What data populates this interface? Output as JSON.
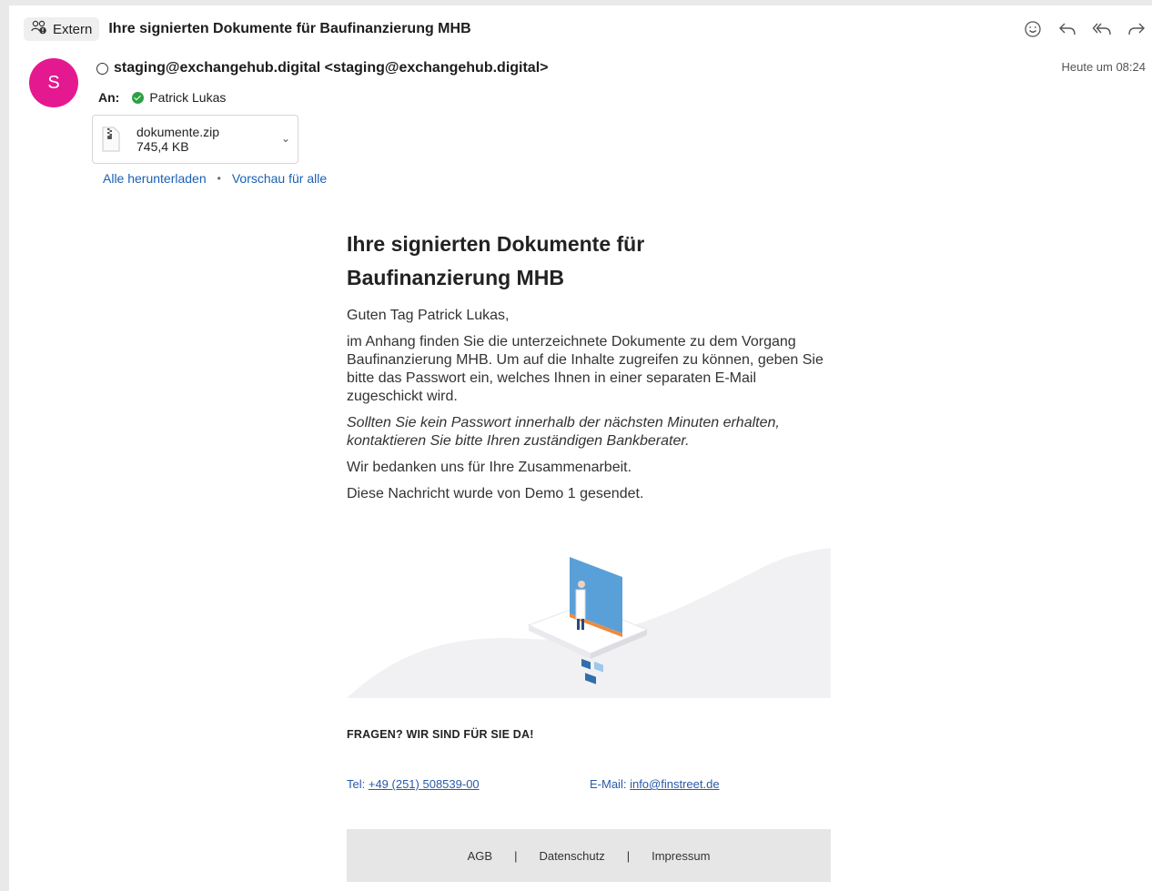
{
  "header": {
    "tag_label": "Extern",
    "subject": "Ihre signierten Dokumente für Baufinanzierung MHB",
    "actions": [
      "emoji-icon",
      "reply-icon",
      "reply-all-icon",
      "forward-icon"
    ]
  },
  "sender": {
    "avatar_letter": "S",
    "avatar_color": "#e4198f",
    "from": "staging@exchangehub.digital <staging@exchangehub.digital>",
    "date": "Heute um 08:24"
  },
  "recipients": {
    "label": "An:",
    "name": "Patrick Lukas"
  },
  "attachment": {
    "name": "dokumente.zip",
    "size": "745,4 KB",
    "download_all": "Alle herunterladen",
    "separator": "•",
    "preview_all": "Vorschau für alle"
  },
  "body": {
    "title": "Ihre signierten Dokumente für Baufinanzierung MHB",
    "greeting": "Guten Tag Patrick Lukas,",
    "paragraph1": "im Anhang finden Sie die unterzeichnete Dokumente zu dem Vorgang Baufinanzierung MHB. Um auf die Inhalte zugreifen zu können, geben Sie bitte das Passwort ein, welches Ihnen in einer separaten E-Mail zugeschickt wird.",
    "paragraph2": "Sollten Sie kein Passwort innerhalb der nächsten Minuten erhalten, kontaktieren Sie bitte Ihren zuständigen Bankberater.",
    "thanks": "Wir bedanken uns für Ihre Zusammenarbeit.",
    "sent_by": "Diese Nachricht wurde von Demo 1 gesendet."
  },
  "help": {
    "heading": "FRAGEN? WIR SIND FÜR SIE DA!",
    "tel_label": "Tel:",
    "tel_value": "+49 (251) 508539-00",
    "email_label": "E-Mail:",
    "email_value": "info@finstreet.de"
  },
  "footer": {
    "agb": "AGB",
    "pipe": "|",
    "privacy": "Datenschutz",
    "imprint": "Impressum"
  }
}
